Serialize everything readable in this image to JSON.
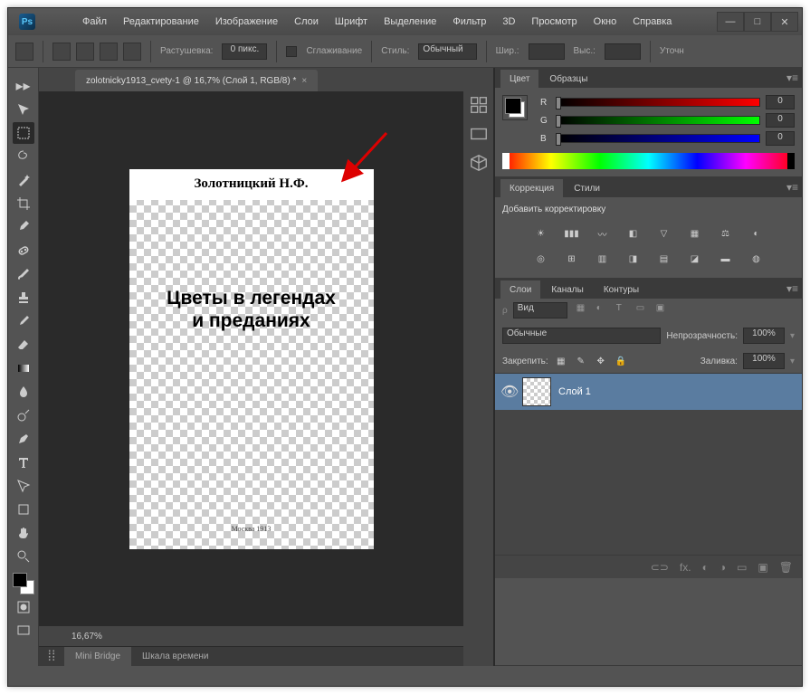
{
  "titlebar": {
    "logo": "Ps"
  },
  "window_controls": {
    "minimize": "—",
    "maximize": "□",
    "close": "✕"
  },
  "menubar": [
    "Файл",
    "Редактирование",
    "Изображение",
    "Слои",
    "Шрифт",
    "Выделение",
    "Фильтр",
    "3D",
    "Просмотр",
    "Окно",
    "Справка"
  ],
  "options": {
    "feather_label": "Растушевка:",
    "feather_value": "0 пикс.",
    "antialias_label": "Сглаживание",
    "style_label": "Стиль:",
    "style_value": "Обычный",
    "width_label": "Шир.:",
    "height_label": "Выс.:",
    "refine": "Уточн"
  },
  "doc_tab": {
    "title": "zolotnicky1913_cvety-1 @ 16,7% (Слой 1, RGB/8) *",
    "close": "×"
  },
  "canvas": {
    "author": "Золотницкий Н.Ф.",
    "title_l1": "Цветы в легендах",
    "title_l2": "и преданиях",
    "footer": "Москва\n1913"
  },
  "status": {
    "zoom": "16,67%"
  },
  "bottom_tabs": {
    "mini_bridge": "Mini Bridge",
    "timeline": "Шкала времени"
  },
  "panels": {
    "color": {
      "tab1": "Цвет",
      "tab2": "Образцы",
      "r": "R",
      "g": "G",
      "b": "B",
      "val": "0"
    },
    "adjust": {
      "tab1": "Коррекция",
      "tab2": "Стили",
      "subtitle": "Добавить корректировку"
    },
    "layers": {
      "tab1": "Слои",
      "tab2": "Каналы",
      "tab3": "Контуры",
      "kind_label": "Вид",
      "blend": "Обычные",
      "opacity_label": "Непрозрачность:",
      "opacity_val": "100%",
      "lock_label": "Закрепить:",
      "fill_label": "Заливка:",
      "fill_val": "100%",
      "layer1": "Слой 1"
    }
  },
  "layers_footer": {
    "link": "⊂⊃",
    "fx": "fx.",
    "mask": "◐",
    "adjust": "◑",
    "group": "▭",
    "new": "▣",
    "trash": "🗑"
  },
  "tool_names": [
    "move",
    "marquee",
    "lasso",
    "magic-wand",
    "crop",
    "eyedropper",
    "healing",
    "brush",
    "stamp",
    "history-brush",
    "eraser",
    "gradient",
    "blur",
    "dodge",
    "pen",
    "type",
    "path-select",
    "rectangle",
    "hand",
    "zoom"
  ]
}
